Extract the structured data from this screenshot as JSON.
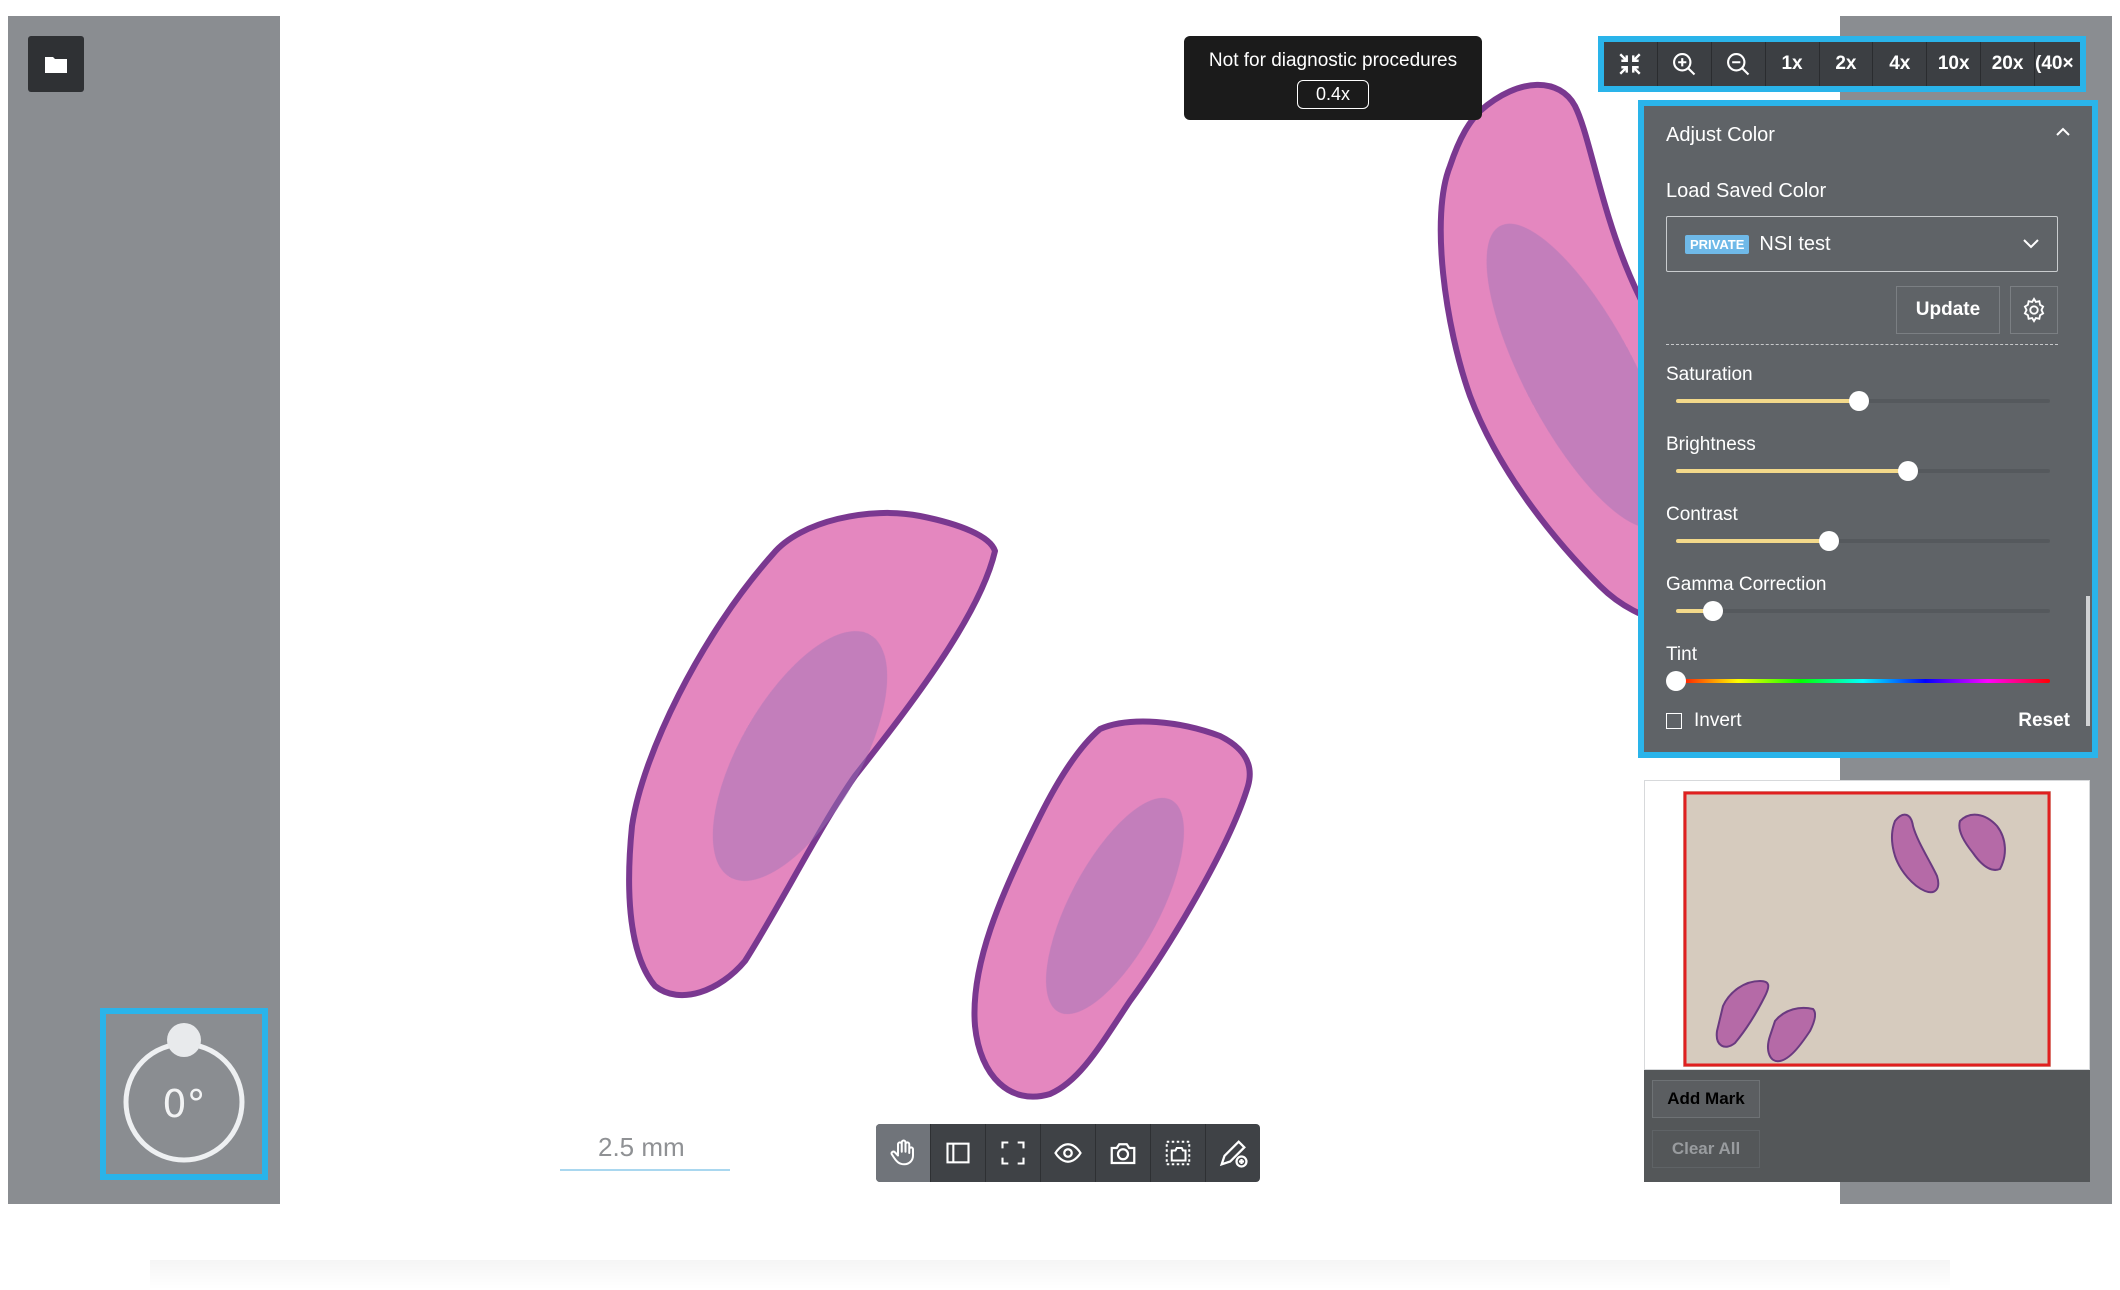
{
  "banner": {
    "text": "Not for diagnostic procedures",
    "zoom": "0.4x"
  },
  "zoom_bar": {
    "buttons": [
      "1x",
      "2x",
      "4x",
      "10x",
      "20x",
      "(40×"
    ]
  },
  "adjust_color": {
    "title": "Adjust Color",
    "load_label": "Load Saved Color",
    "selected": {
      "badge": "PRIVATE",
      "name": "NSI test"
    },
    "update_label": "Update",
    "sliders": [
      {
        "label": "Saturation",
        "value": 0.49
      },
      {
        "label": "Brightness",
        "value": 0.62
      },
      {
        "label": "Contrast",
        "value": 0.41
      },
      {
        "label": "Gamma Correction",
        "value": 0.1
      },
      {
        "label": "Tint",
        "value": 0.0
      }
    ],
    "invert_label": "Invert",
    "reset_label": "Reset"
  },
  "marks": {
    "add_label": "Add Mark",
    "clear_label": "Clear All"
  },
  "rotation": {
    "label": "0°"
  },
  "scale_bar": {
    "label": "2.5 mm"
  },
  "colors": {
    "accent": "#2ab4ea",
    "tissue": "#d86aa8",
    "tissue_dark": "#7d3a8c",
    "thumb_bg": "#d6cbbe",
    "viewport": "#e02020"
  }
}
